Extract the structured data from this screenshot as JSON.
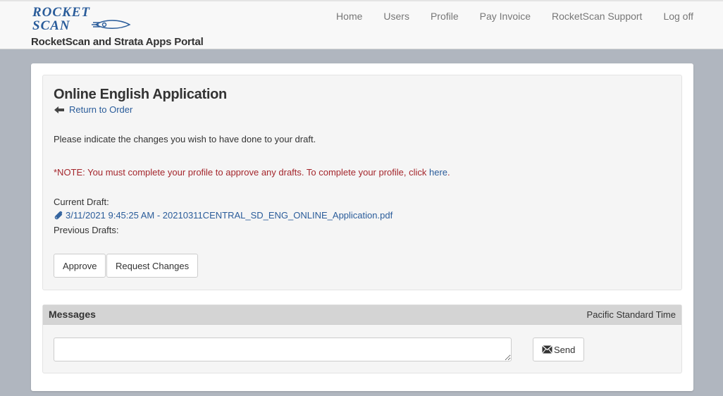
{
  "header": {
    "logo_line1": "ROCKET",
    "logo_line2": "SCAN",
    "portal_title": "RocketScan and Strata Apps Portal",
    "nav": [
      "Home",
      "Users",
      "Profile",
      "Pay Invoice",
      "RocketScan Support",
      "Log off"
    ]
  },
  "main": {
    "title": "Online English Application",
    "return_link": "Return to Order",
    "instructions": "Please indicate the changes you wish to have done to your draft.",
    "note_text": "*NOTE: You must complete your profile to approve any drafts. To complete your profile, click ",
    "note_link": "here",
    "note_end": ".",
    "current_draft_label": "Current Draft:",
    "current_draft_file": "3/11/2021 9:45:25 AM - 20210311CENTRAL_SD_ENG_ONLINE_Application.pdf",
    "previous_drafts_label": "Previous Drafts:",
    "approve_label": "Approve",
    "request_changes_label": "Request Changes"
  },
  "messages": {
    "title": "Messages",
    "timezone": "Pacific Standard Time",
    "input_value": "",
    "send_label": "Send"
  },
  "colors": {
    "page_background": "#b0b6bf",
    "link": "#2a5c9a",
    "note": "#a4262c",
    "logo": "#2a5c9a"
  }
}
